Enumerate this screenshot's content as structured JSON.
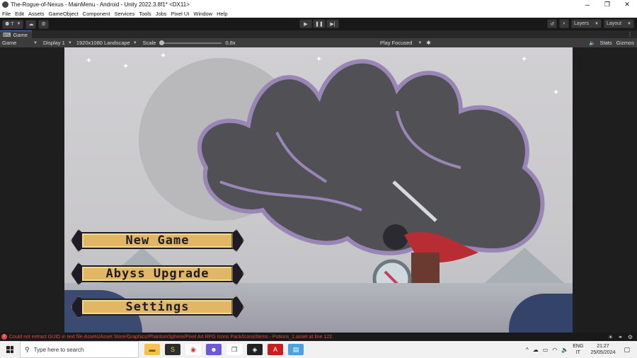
{
  "window": {
    "title": "The-Rogue-of-Nexus - MainMenu - Android - Unity 2022.3.8f1* <DX11>",
    "controls": [
      "─",
      "❐",
      "✕"
    ]
  },
  "menubar": [
    "File",
    "Edit",
    "Assets",
    "GameObject",
    "Component",
    "Services",
    "Tools",
    "Jobs",
    "Pixel UI",
    "Window",
    "Help"
  ],
  "toolbar": {
    "account_label": "T",
    "layers_label": "Layers",
    "layout_label": "Layout"
  },
  "tab": {
    "label": "Game"
  },
  "game_view": {
    "mode": "Game",
    "display": "Display 1",
    "resolution": "1920x1080 Landscape",
    "scale_label": "Scale",
    "scale_value": "0.8x",
    "scale_fraction": 0.0,
    "play_mode": "Play Focused",
    "stats": "Stats",
    "gizmos": "Gizmos"
  },
  "game_menu": {
    "buttons": [
      "New Game",
      "Abyss Upgrade",
      "Settings"
    ]
  },
  "console": {
    "message": "Could not extract GUID in text file Assets/Asset Store/Graphics/PhantomSphere/Pixel Art RPG Icons Pack/Icons/Items - Potions_1.asset at line 122."
  },
  "taskbar": {
    "search_placeholder": "Type here to search",
    "lang_top": "ENG",
    "lang_bottom": "IT",
    "time": "21:27",
    "date": "25/05/2024"
  },
  "colors": {
    "editor_bg": "#191919",
    "button_gold": "#e1b765",
    "error_red": "#e04848"
  }
}
